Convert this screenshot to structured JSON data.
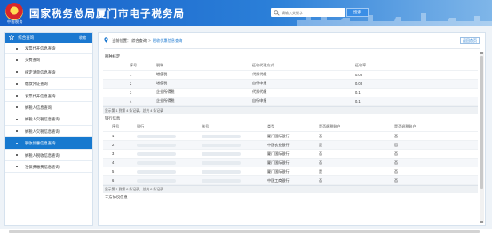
{
  "header": {
    "title": "国家税务总局厦门市电子税务局",
    "logo_sub": "中国税务",
    "search_placeholder": "请输入关键字",
    "search_button": "搜索"
  },
  "sidebar": {
    "title": "综合查询",
    "collapse_label": "收缩",
    "items": [
      {
        "label": "发票代开信息查询",
        "active": false
      },
      {
        "label": "交费查询",
        "active": false
      },
      {
        "label": "核定清单信息查询",
        "active": false
      },
      {
        "label": "缴款凭证查询",
        "active": false
      },
      {
        "label": "发票代开信息查询",
        "active": false
      },
      {
        "label": "纳税人信息查询",
        "active": false
      },
      {
        "label": "纳税人欠税信息查询",
        "active": false
      },
      {
        "label": "纳税人欠税信息查询",
        "active": false
      },
      {
        "label": "税收优惠信息查询",
        "active": true
      },
      {
        "label": "纳税人税收信息查询",
        "active": false
      },
      {
        "label": "社保费缴费信息查询",
        "active": false
      }
    ]
  },
  "main": {
    "breadcrumb": {
      "label": "当前位置：",
      "level1": "综合查询",
      "sep": ">",
      "current": "税收优惠信息查询"
    },
    "back_button": "返回首页",
    "section1": {
      "title": "税种核定",
      "columns": [
        "序号",
        "税种",
        "征收代理方式",
        "征收率"
      ],
      "rows": [
        [
          "1",
          "增值税",
          "代扣代缴",
          "0.03"
        ],
        [
          "2",
          "增值税",
          "自行申报",
          "0.03"
        ],
        [
          "3",
          "企业所得税",
          "代扣代缴",
          "0.1"
        ],
        [
          "4",
          "企业所得税",
          "自行申报",
          "0.1"
        ]
      ],
      "pager": "显示第 1 到第 4 条记录，总共 4 条记录"
    },
    "section2": {
      "title": "银行信息",
      "columns": [
        "序号",
        "银行",
        "账号",
        "类型",
        "是否缴税账户",
        "是否退税账户"
      ],
      "rows": [
        [
          "1",
          "",
          "",
          "厦门国际银行",
          "否",
          "否"
        ],
        [
          "2",
          "",
          "",
          "中国农业银行",
          "是",
          "否"
        ],
        [
          "3",
          "",
          "",
          "厦门国际银行",
          "否",
          "否"
        ],
        [
          "4",
          "",
          "",
          "厦门国际银行",
          "否",
          "否"
        ],
        [
          "5",
          "",
          "",
          "厦门国际银行",
          "是",
          "否"
        ],
        [
          "6",
          "",
          "",
          "中国工商银行",
          "否",
          "否"
        ]
      ],
      "pager": "显示第 1 到第 6 条记录，总共 6 条记录"
    },
    "section3": {
      "title": "三方协议信息"
    }
  }
}
